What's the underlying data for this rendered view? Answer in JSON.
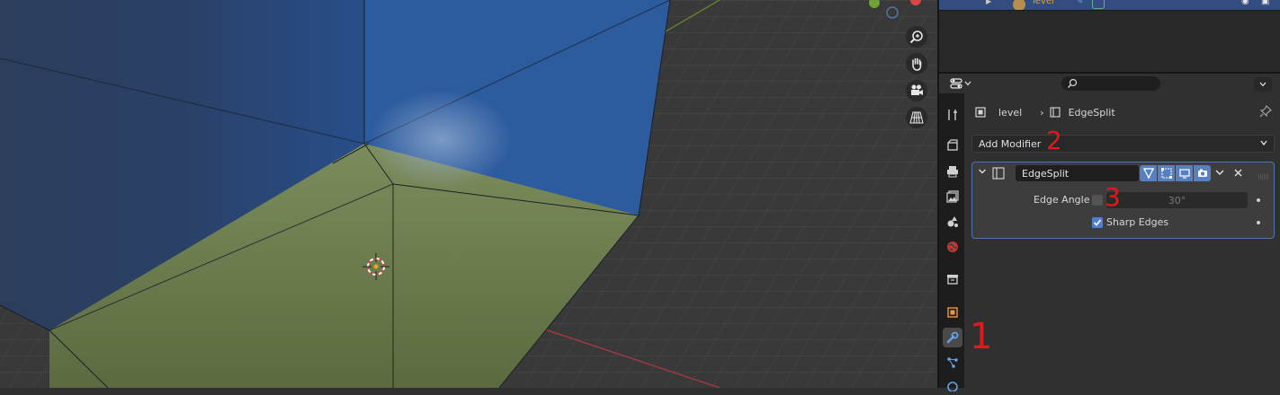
{
  "outliner": {
    "object_name": "level"
  },
  "properties": {
    "breadcrumb": {
      "object": "level",
      "modifier": "EdgeSplit"
    },
    "add_modifier_label": "Add Modifier",
    "modifier": {
      "name": "EdgeSplit",
      "edge_angle_label": "Edge Angle",
      "edge_angle_value": "30°",
      "edge_angle_enabled": false,
      "sharp_edges_label": "Sharp Edges",
      "sharp_edges_enabled": true
    },
    "tabs": [
      "tool-icon",
      "render-icon",
      "output-icon",
      "view-layer-icon",
      "scene-icon",
      "world-icon",
      "collection-icon",
      "object-icon",
      "modifier-icon",
      "particles-icon",
      "physics-icon"
    ],
    "active_tab": "modifier-icon"
  },
  "annotations": {
    "marker_1": "1",
    "marker_2": "2",
    "marker_3": "3"
  },
  "colors": {
    "accent": "#5680c2",
    "annotation": "#e01a1a",
    "active_row": "#334d80"
  }
}
